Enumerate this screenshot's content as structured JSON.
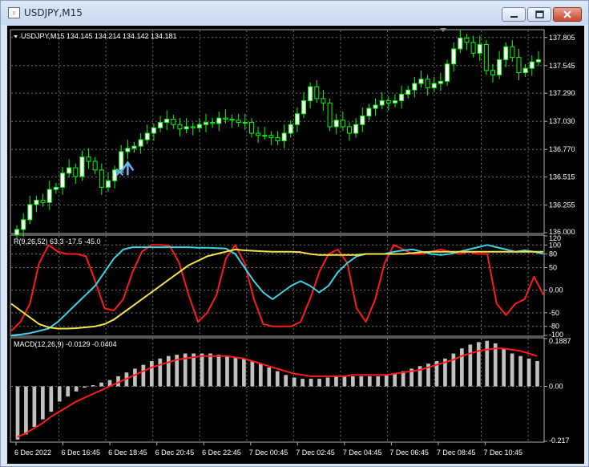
{
  "window": {
    "title": "USDJPY,M15",
    "icon": "chart-window-icon",
    "controls": [
      "minimize-icon",
      "maximize-icon",
      "close-icon"
    ]
  },
  "colors": {
    "background": "#000000",
    "grid": "#6e6e6e",
    "bull_candle": "#ffffff",
    "bear_candle": "#000000",
    "wick": "#00ff00",
    "rsi_red": "#ff1a1a",
    "rsi_cyan": "#3fd3e8",
    "rsi_yellow": "#f5e54a",
    "macd_hist": "#c0c0c0",
    "macd_signal": "#ff1a1a",
    "arrow": "#6fb4f0"
  },
  "chart_data": [
    {
      "type": "candlestick",
      "title": "USDJPY,M15  134.145 134.214 134.142 134.181",
      "symbol": "USDJPY,M15",
      "quote": "134.145 134.214 134.142 134.181",
      "ylim": [
        136.0,
        137.87
      ],
      "y_ticks": [
        "137.805",
        "137.545",
        "137.290",
        "137.030",
        "136.770",
        "136.515",
        "136.255",
        "136.000"
      ],
      "y_tick_values": [
        137.805,
        137.545,
        137.29,
        137.03,
        136.77,
        136.515,
        136.255,
        136.0
      ],
      "x_ticks": [
        "6 Dec 2022",
        "6 Dec 16:45",
        "6 Dec 18:45",
        "6 Dec 20:45",
        "6 Dec 22:45",
        "7 Dec 00:45",
        "7 Dec 02:45",
        "7 Dec 04:45",
        "7 Dec 06:45",
        "7 Dec 08:45",
        "7 Dec 10:45"
      ],
      "close_series": [
        136.03,
        136.12,
        136.26,
        136.3,
        136.28,
        136.4,
        136.42,
        136.55,
        136.6,
        136.52,
        136.7,
        136.66,
        136.58,
        136.42,
        136.48,
        136.58,
        136.75,
        136.78,
        136.8,
        136.86,
        136.92,
        136.97,
        137.02,
        137.05,
        137.0,
        136.96,
        136.98,
        136.97,
        137.0,
        137.02,
        137.01,
        137.06,
        137.05,
        137.04,
        137.02,
        137.02,
        136.92,
        136.9,
        136.9,
        136.88,
        136.85,
        136.92,
        137.0,
        137.1,
        137.22,
        137.35,
        137.24,
        137.2,
        136.98,
        137.04,
        136.98,
        136.92,
        137.0,
        137.08,
        137.15,
        137.18,
        137.22,
        137.2,
        137.22,
        137.28,
        137.32,
        137.38,
        137.42,
        137.34,
        137.38,
        137.4,
        137.56,
        137.7,
        137.8,
        137.76,
        137.66,
        137.74,
        137.5,
        137.46,
        137.6,
        137.72,
        137.62,
        137.48,
        137.52,
        137.58,
        137.6
      ],
      "annotation": "buy-arrow"
    },
    {
      "type": "line",
      "title": "R(9,26,52) 63.3 -17.5 -45.0",
      "ylim": [
        -100,
        120
      ],
      "y_ticks": [
        "120",
        "100",
        "80",
        "50",
        "0.00",
        "-50",
        "-80",
        "-100"
      ],
      "y_tick_values": [
        120,
        100,
        80,
        50,
        0,
        -50,
        -80,
        -100
      ],
      "series": [
        {
          "values": [
            -90,
            -70,
            -30,
            60,
            100,
            85,
            80,
            80,
            75,
            20,
            -40,
            -45,
            -20,
            40,
            85,
            100,
            100,
            98,
            60,
            -10,
            -70,
            -50,
            -10,
            70,
            100,
            60,
            -20,
            -75,
            -80,
            -80,
            -80,
            -70,
            -20,
            40,
            80,
            90,
            60,
            -40,
            -70,
            -20,
            60,
            100,
            90,
            80,
            80,
            85,
            90,
            85,
            80,
            85,
            80,
            80,
            -30,
            -55,
            -30,
            -20,
            30,
            -10
          ]
        },
        {
          "values": [
            -100,
            -98,
            -95,
            -90,
            -85,
            -70,
            -50,
            -30,
            -10,
            10,
            40,
            70,
            90,
            95,
            95,
            95,
            95,
            95,
            95,
            95,
            94,
            94,
            93,
            92,
            80,
            50,
            20,
            -5,
            -20,
            -5,
            10,
            20,
            10,
            -5,
            10,
            40,
            60,
            75,
            80,
            80,
            80,
            85,
            88,
            90,
            85,
            80,
            78,
            80,
            85,
            90,
            95,
            100,
            95,
            90,
            85,
            88,
            85,
            80
          ]
        },
        {
          "values": [
            -30,
            -45,
            -60,
            -75,
            -82,
            -85,
            -85,
            -84,
            -82,
            -80,
            -75,
            -65,
            -50,
            -35,
            -20,
            -5,
            10,
            25,
            40,
            55,
            65,
            75,
            80,
            85,
            90,
            88,
            87,
            86,
            85,
            85,
            85,
            84,
            80,
            78,
            78,
            78,
            78,
            78,
            80,
            80,
            80,
            80,
            80,
            82,
            84,
            85,
            85,
            85,
            85,
            85,
            85,
            85,
            85,
            85,
            85,
            85,
            85,
            85
          ]
        }
      ]
    },
    {
      "type": "bar",
      "title": "MACD(12,26,9) -0.0129 -0.0404",
      "ylim": [
        -0.217,
        0.1887
      ],
      "y_ticks": [
        "0.1887",
        "0.00",
        "-0.217"
      ],
      "y_tick_values": [
        0.1887,
        0.0,
        -0.217
      ],
      "values": [
        -0.21,
        -0.19,
        -0.16,
        -0.13,
        -0.1,
        -0.06,
        -0.04,
        -0.02,
        -0.005,
        0.005,
        0.015,
        0.025,
        0.04,
        0.055,
        0.07,
        0.085,
        0.1,
        0.11,
        0.12,
        0.125,
        0.13,
        0.13,
        0.13,
        0.13,
        0.125,
        0.12,
        0.115,
        0.11,
        0.1,
        0.09,
        0.075,
        0.06,
        0.045,
        0.035,
        0.03,
        0.03,
        0.03,
        0.035,
        0.04,
        0.04,
        0.04,
        0.04,
        0.04,
        0.04,
        0.045,
        0.05,
        0.06,
        0.07,
        0.08,
        0.09,
        0.1,
        0.11,
        0.13,
        0.15,
        0.165,
        0.175,
        0.18,
        0.17,
        0.15,
        0.13,
        0.12,
        0.11,
        0.1
      ],
      "series": [
        {
          "values": [
            -0.2,
            -0.185,
            -0.165,
            -0.145,
            -0.12,
            -0.1,
            -0.08,
            -0.06,
            -0.045,
            -0.03,
            -0.015,
            0.0,
            0.015,
            0.03,
            0.045,
            0.06,
            0.075,
            0.085,
            0.095,
            0.105,
            0.11,
            0.115,
            0.12,
            0.12,
            0.12,
            0.12,
            0.115,
            0.11,
            0.1,
            0.09,
            0.08,
            0.07,
            0.06,
            0.05,
            0.045,
            0.04,
            0.04,
            0.04,
            0.04,
            0.04,
            0.045,
            0.045,
            0.045,
            0.045,
            0.045,
            0.05,
            0.055,
            0.06,
            0.065,
            0.075,
            0.085,
            0.095,
            0.105,
            0.12,
            0.13,
            0.14,
            0.145,
            0.15,
            0.15,
            0.145,
            0.14,
            0.13,
            0.12
          ]
        }
      ]
    }
  ]
}
